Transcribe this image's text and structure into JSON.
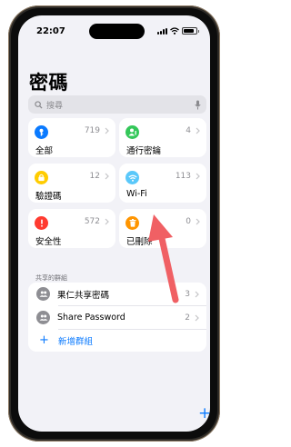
{
  "status_bar": {
    "time": "22:07"
  },
  "header": {
    "title": "密碼"
  },
  "search": {
    "placeholder": "搜尋"
  },
  "categories": [
    {
      "label": "全部",
      "count": "719",
      "icon": "key-icon",
      "color": "#0a7aff"
    },
    {
      "label": "通行密鑰",
      "count": "4",
      "icon": "person-key-icon",
      "color": "#34c759"
    },
    {
      "label": "驗證碼",
      "count": "12",
      "icon": "lock-clock-icon",
      "color": "#ffcc00"
    },
    {
      "label": "Wi-Fi",
      "count": "113",
      "icon": "wifi-icon",
      "color": "#5ac8fa"
    },
    {
      "label": "安全性",
      "count": "572",
      "icon": "exclamation-icon",
      "color": "#ff3b30"
    },
    {
      "label": "已刪除",
      "count": "0",
      "icon": "trash-icon",
      "color": "#ff9500"
    }
  ],
  "shared_groups": {
    "header": "共享的群組",
    "items": [
      {
        "label": "果仁共享密碼",
        "count": "3",
        "icon": "group-icon"
      },
      {
        "label": "Share Password",
        "count": "2",
        "icon": "group-icon"
      }
    ],
    "add_label": "新增群組"
  },
  "fab": {
    "label": "+"
  },
  "colors": {
    "accent": "#0a7aff",
    "annotation_arrow": "#f06064"
  }
}
